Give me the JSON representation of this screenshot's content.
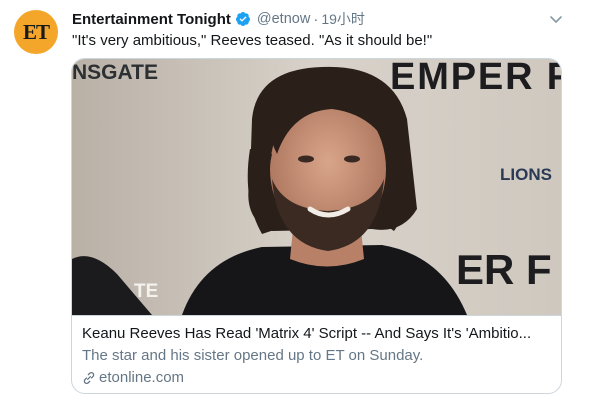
{
  "tweet": {
    "avatar_text": "ET",
    "author_name": "Entertainment Tonight",
    "handle": "@etnow",
    "separator": "·",
    "time": "19小时",
    "text": "\"It's very ambitious,\" Reeves teased. \"As it should be!\""
  },
  "card": {
    "image_texts": {
      "left_banner": "NSGATE",
      "right_banner": "EMPER F",
      "right_logo": "LIONS",
      "bottom_right": "ER F",
      "bottom_left": "TE"
    },
    "title": "Keanu Reeves Has Read 'Matrix 4' Script -- And Says It's 'Ambitio...",
    "description": "The star and his sister opened up to ET on Sunday.",
    "domain": "etonline.com"
  },
  "colors": {
    "verified": "#1da1f2",
    "avatar_bg": "#f4a62a",
    "secondary_text": "#657786",
    "border": "#ccd6dd"
  },
  "icons": [
    "verified-badge-icon",
    "chevron-down-icon",
    "link-icon"
  ]
}
